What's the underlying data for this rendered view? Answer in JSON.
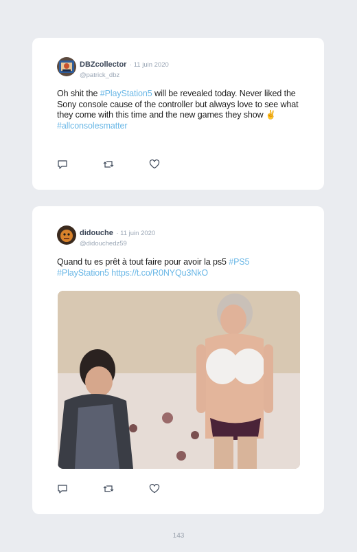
{
  "tweets": [
    {
      "display_name": "DBZcollector",
      "date": "· 11 juin 2020",
      "handle": "@patrick_dbz",
      "text_parts": [
        "Oh shit the ",
        "#PlayStation5",
        " will be revealed today. Never liked the Sony console cause of the controller but always love to see what they come with this time and the new games they show ",
        "✌",
        "#allconsolesmatter"
      ]
    },
    {
      "display_name": "didouche",
      "date": "· 11 juin 2020",
      "handle": "@didouchedz59",
      "text_parts": [
        "Quand tu es prêt à tout faire pour avoir la ps5 ",
        "#PS5",
        "#PlayStation5",
        " ",
        "https://t.co/R0NYQu3NkO"
      ]
    }
  ],
  "icons": [
    "reply-icon",
    "retweet-icon",
    "like-icon"
  ],
  "colors": {
    "link": "#6ab7e6",
    "name": "#3a4556",
    "muted": "#9aa6b5",
    "background": "#eaecf0"
  },
  "page_number": "143"
}
